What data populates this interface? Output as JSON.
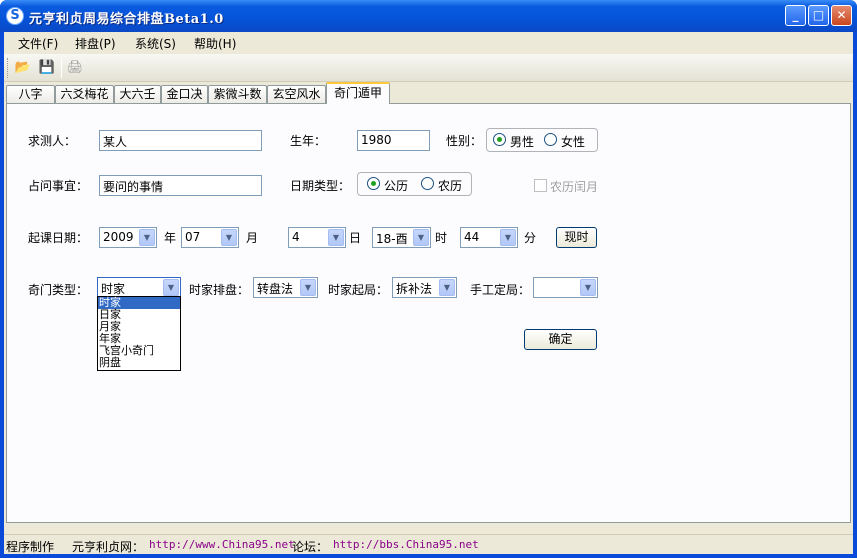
{
  "window": {
    "title": "元亨利贞周易综合排盘Beta1.0",
    "icon_glyph": "S"
  },
  "menu": [
    "文件(F)",
    "排盘(P)",
    "系统(S)",
    "帮助(H)"
  ],
  "toolbar": {
    "icons": [
      "open-folder-icon",
      "save-icon",
      "print-icon"
    ]
  },
  "tabs": [
    "八字",
    "六爻梅花",
    "大六壬",
    "金口决",
    "紫微斗数",
    "玄空风水",
    "奇门遁甲"
  ],
  "active_tab": "奇门遁甲",
  "form": {
    "asker_label": "求测人：",
    "asker_value": "某人",
    "birth_year_label": "生年：",
    "birth_year_value": "1980",
    "gender_label": "性别：",
    "male": "男性",
    "female": "女性",
    "gender_selected": "男性",
    "matter_label": "占问事宜：",
    "matter_value": "要问的事情",
    "date_type_label": "日期类型：",
    "solar": "公历",
    "lunar": "农历",
    "date_type_selected": "公历",
    "leap_month": "农历闰月",
    "start_date_label": "起课日期：",
    "year_value": "2009",
    "year_unit": "年",
    "month_value": "07",
    "month_unit": "月",
    "day_value": "4",
    "day_unit": "日",
    "hour_value": "18-酉",
    "hour_unit": "时",
    "minute_value": "44",
    "minute_unit": "分",
    "now_button": "现时",
    "qimen_type_label": "奇门类型：",
    "qimen_type_value": "时家",
    "hour_method_label": "时家排盘：",
    "hour_method_value": "转盘法",
    "hour_start_label": "时家起局：",
    "hour_start_value": "拆补法",
    "manual_label": "手工定局：",
    "manual_value": "",
    "confirm_button": "确定",
    "qimen_type_options": [
      "时家",
      "日家",
      "月家",
      "年家",
      "飞宫小奇门",
      "阴盘"
    ]
  },
  "status": {
    "maker": "程序制作",
    "site_label": "元亨利贞网：",
    "site_url": "http://www.China95.net",
    "forum_label": "论坛：",
    "forum_url": "http://bbs.China95.net"
  },
  "colors": {
    "title_bar": "#0553d8",
    "client_bg": "#ece9d8",
    "selected_item": "#316ac5",
    "link": "#8b008b"
  }
}
